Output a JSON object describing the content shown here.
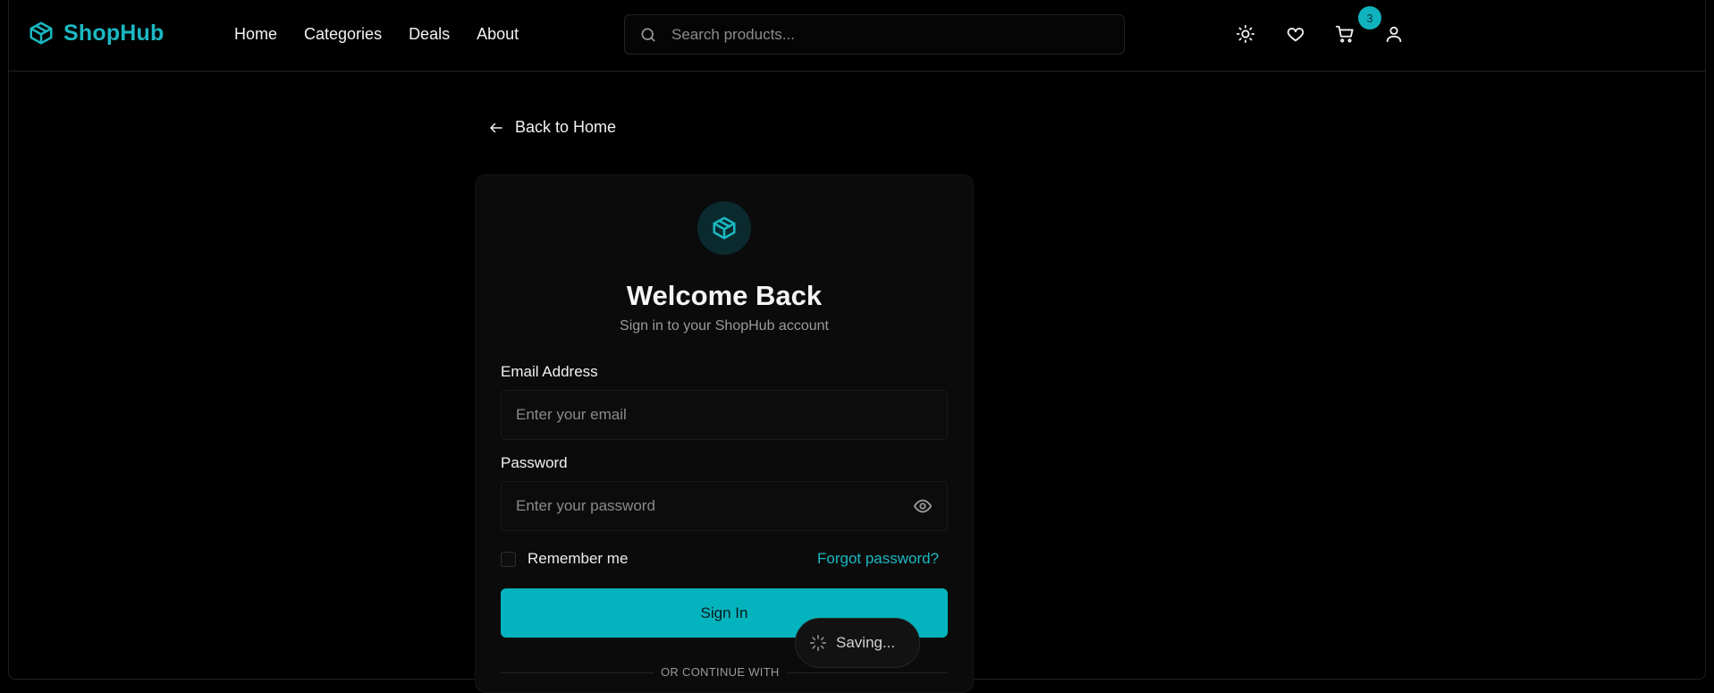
{
  "brand": {
    "name": "ShopHub",
    "accent": "#1ab8c2",
    "logo_icon": "package-icon"
  },
  "nav": {
    "links": [
      "Home",
      "Categories",
      "Deals",
      "About"
    ]
  },
  "search": {
    "placeholder": "Search products...",
    "icon": "search-icon"
  },
  "header_actions": {
    "theme_icon": "sun-icon",
    "wishlist_icon": "heart-icon",
    "cart_icon": "cart-icon",
    "cart_count": "3",
    "account_icon": "user-icon"
  },
  "back_link": {
    "label": "Back to Home",
    "icon": "arrow-left-icon"
  },
  "login": {
    "title": "Welcome Back",
    "subtitle": "Sign in to your ShopHub account",
    "email_label": "Email Address",
    "email_placeholder": "Enter your email",
    "password_label": "Password",
    "password_placeholder": "Enter your password",
    "remember_label": "Remember me",
    "remember_checked": false,
    "forgot_label": "Forgot password?",
    "submit_label": "Sign In",
    "divider_label": "OR CONTINUE WITH"
  },
  "toast": {
    "label": "Saving...",
    "icon": "spinner-icon"
  }
}
